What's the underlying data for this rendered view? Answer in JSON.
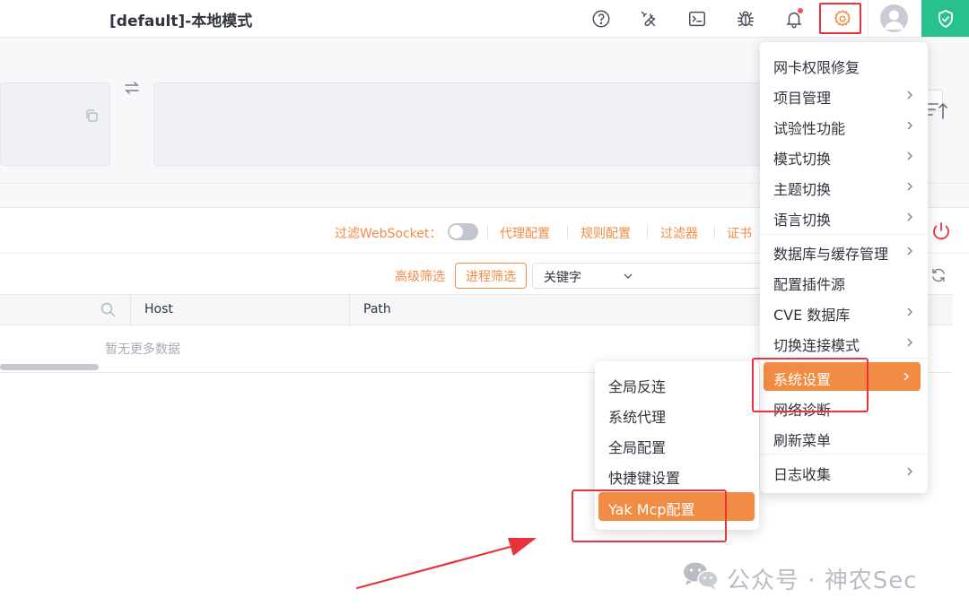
{
  "window": {
    "title": "[default]-本地模式"
  },
  "toolbar": {
    "filter_ws_label": "过滤WebSocket：",
    "proxy_config": "代理配置",
    "rule_config": "规则配置",
    "filter": "过滤器",
    "cert": "证书"
  },
  "filterbar": {
    "advanced_filter": "高级筛选",
    "process_filter": "进程筛选",
    "keyword_select": "关键字"
  },
  "table": {
    "columns": [
      "Host",
      "Path"
    ],
    "empty": "暂无更多数据"
  },
  "main_menu": {
    "items": [
      {
        "label": "网卡权限修复",
        "submenu": false
      },
      {
        "label": "项目管理",
        "submenu": true
      },
      {
        "label": "试验性功能",
        "submenu": true
      },
      {
        "label": "模式切换",
        "submenu": true
      },
      {
        "label": "主题切换",
        "submenu": true
      },
      {
        "label": "语言切换",
        "submenu": true
      },
      {
        "label": "数据库与缓存管理",
        "submenu": true
      },
      {
        "label": "配置插件源",
        "submenu": false
      },
      {
        "label": "CVE 数据库",
        "submenu": true
      },
      {
        "label": "切换连接模式",
        "submenu": true
      },
      {
        "label": "系统设置",
        "submenu": true,
        "active": true
      },
      {
        "label": "网络诊断",
        "submenu": false
      },
      {
        "label": "刷新菜单",
        "submenu": false
      },
      {
        "label": "日志收集",
        "submenu": true
      }
    ]
  },
  "sub_menu": {
    "items": [
      {
        "label": "全局反连"
      },
      {
        "label": "系统代理"
      },
      {
        "label": "全局配置"
      },
      {
        "label": "快捷键设置"
      },
      {
        "label": "Yak Mcp配置",
        "active": true
      }
    ]
  },
  "watermark": {
    "text": "公众号 · 神农Sec"
  },
  "colors": {
    "accent": "#f28b44",
    "annotation": "#e8333b",
    "shield": "#28c08e"
  }
}
